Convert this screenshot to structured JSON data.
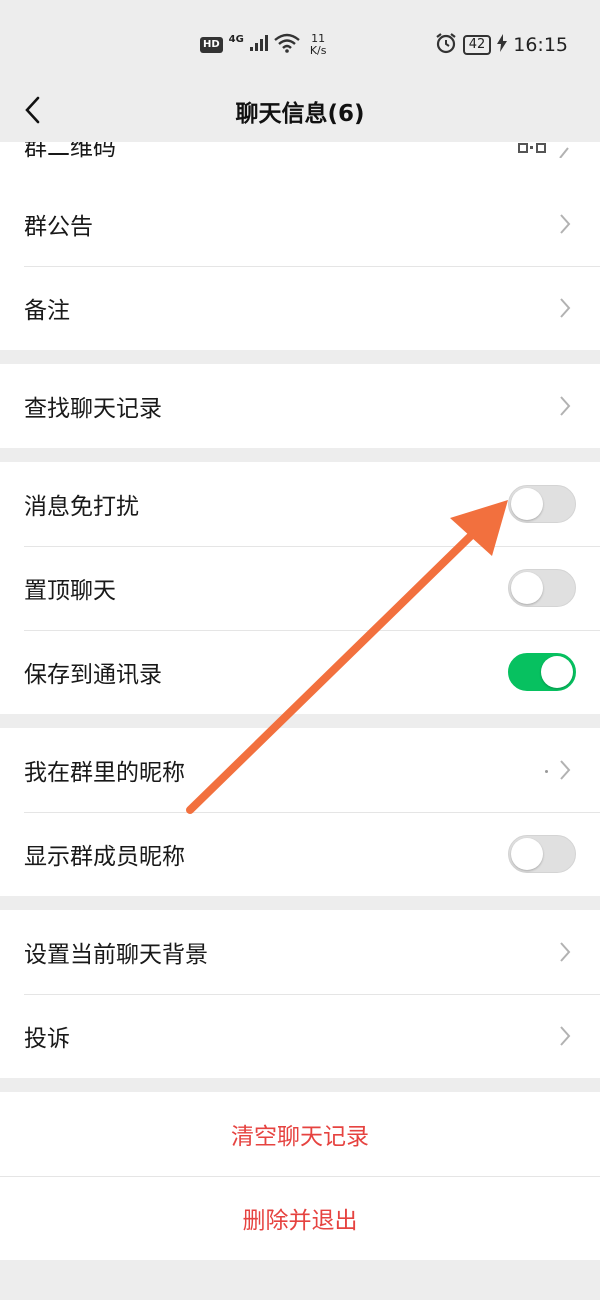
{
  "status_bar": {
    "hd": "HD",
    "network": "4G",
    "speed_value": "11",
    "speed_unit": "K/s",
    "battery": "42",
    "time": "16:15"
  },
  "nav": {
    "title": "聊天信息(6)"
  },
  "rows": {
    "qr_code": "群二维码",
    "announcement": "群公告",
    "remark": "备注",
    "search_history": "查找聊天记录",
    "mute": "消息免打扰",
    "pin": "置顶聊天",
    "save_contacts": "保存到通讯录",
    "my_nickname": "我在群里的昵称",
    "show_nicknames": "显示群成员昵称",
    "background": "设置当前聊天背景",
    "report": "投诉"
  },
  "toggles": {
    "mute": false,
    "pin": false,
    "save_contacts": true,
    "show_nicknames": false
  },
  "actions": {
    "clear_history": "清空聊天记录",
    "delete_exit": "删除并退出"
  },
  "colors": {
    "toggle_on": "#07c160",
    "danger": "#e64340",
    "annotation_arrow": "#f2703e",
    "background": "#ededed"
  }
}
